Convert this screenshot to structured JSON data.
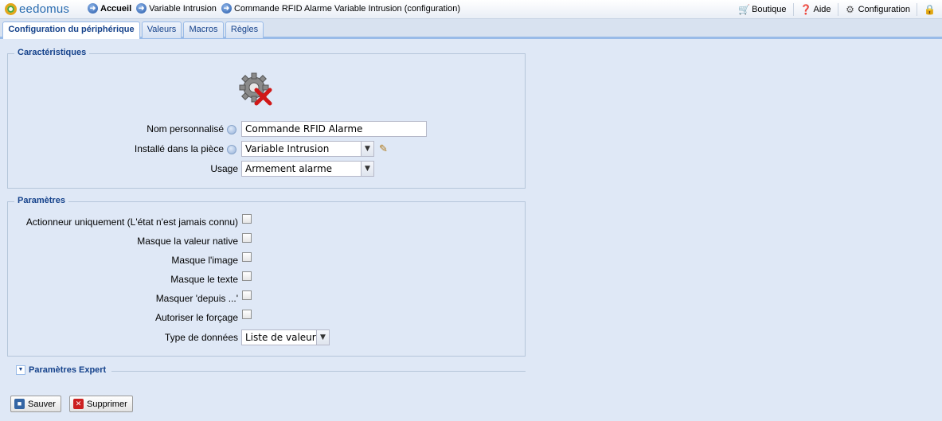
{
  "header": {
    "logo_text": "eedomus",
    "breadcrumb": [
      {
        "label": "Accueil",
        "bold": true
      },
      {
        "label": "Variable Intrusion",
        "bold": false
      },
      {
        "label": "Commande RFID Alarme Variable Intrusion (configuration)",
        "bold": false
      }
    ],
    "links": {
      "boutique": "Boutique",
      "aide": "Aide",
      "configuration": "Configuration"
    }
  },
  "tabs": [
    "Configuration du périphérique",
    "Valeurs",
    "Macros",
    "Règles"
  ],
  "caracteristiques": {
    "legend": "Caractéristiques",
    "nom_label": "Nom personnalisé",
    "nom_value": "Commande RFID Alarme",
    "piece_label": "Installé dans la pièce",
    "piece_value": "Variable Intrusion",
    "usage_label": "Usage",
    "usage_value": "Armement alarme"
  },
  "parametres": {
    "legend": "Paramètres",
    "options": [
      {
        "label": "Actionneur uniquement (L'état n'est jamais connu)",
        "checked": false
      },
      {
        "label": "Masque la valeur native",
        "checked": false
      },
      {
        "label": "Masque l'image",
        "checked": false
      },
      {
        "label": "Masque le texte",
        "checked": false
      },
      {
        "label": "Masquer 'depuis ...'",
        "checked": false
      },
      {
        "label": "Autoriser le forçage",
        "checked": false
      }
    ],
    "type_label": "Type de données",
    "type_value": "Liste de valeurs"
  },
  "expert": {
    "label": "Paramètres Expert"
  },
  "buttons": {
    "save": "Sauver",
    "delete": "Supprimer"
  },
  "colors": {
    "accent": "#15428b",
    "background": "#dfe8f6"
  }
}
